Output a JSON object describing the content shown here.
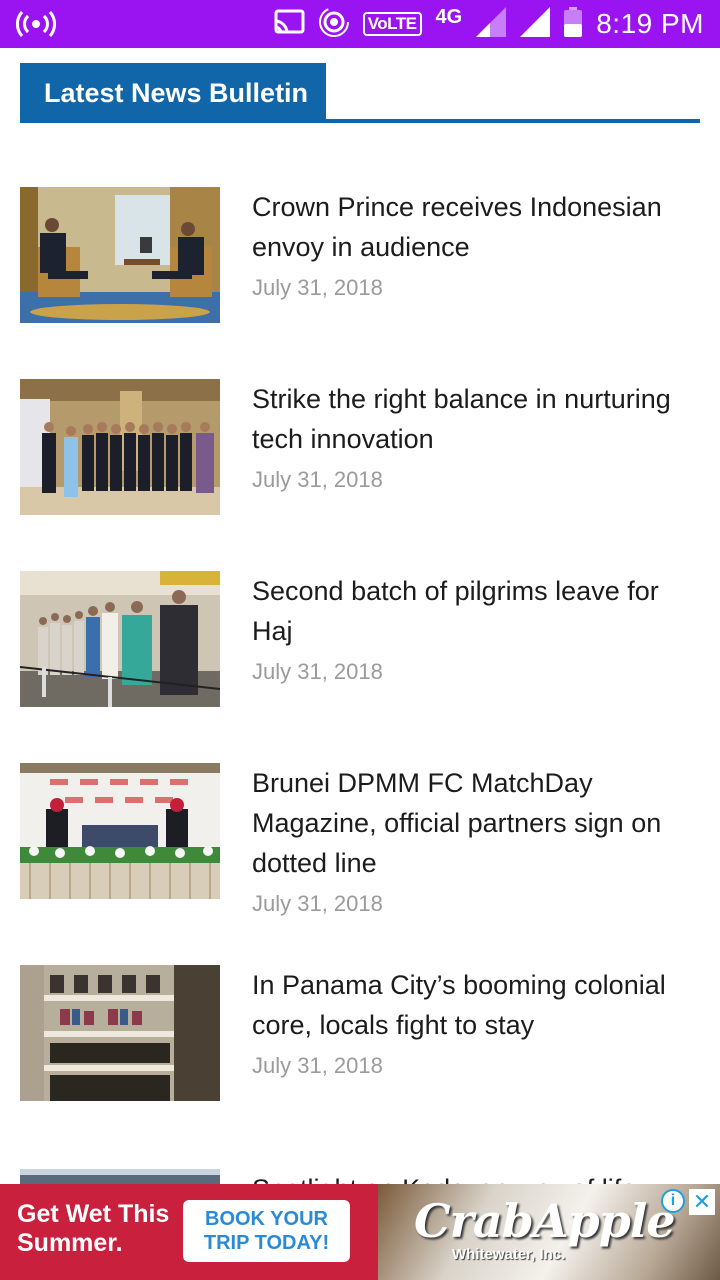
{
  "status_bar": {
    "left_icon": "broadcast-icon",
    "icons": [
      "cast-icon",
      "hotspot-icon",
      "volte-icon",
      "signal-icon",
      "signal-icon",
      "battery-icon"
    ],
    "volte_label": "VoLTE",
    "network_label": "4G",
    "time": "8:19 PM"
  },
  "header": {
    "title": "Latest News Bulletin",
    "accent_color": "#1166aa"
  },
  "news": [
    {
      "headline": "Crown Prince receives Indonesian envoy in audience",
      "date": "July 31, 2018"
    },
    {
      "headline": "Strike the right balance in nurturing tech innovation",
      "date": "July 31, 2018"
    },
    {
      "headline": "Second batch of pilgrims leave for Haj",
      "date": "July 31, 2018"
    },
    {
      "headline": "Brunei DPMM FC MatchDay Magazine, official partners sign on dotted line",
      "date": "July 31, 2018"
    },
    {
      "headline": "In Panama City’s booming colonial core, locals fight to stay",
      "date": "July 31, 2018"
    },
    {
      "headline": "Spotlight on Kedayan way of life",
      "date": ""
    }
  ],
  "ad": {
    "line1": "Get Wet This",
    "line2": "Summer.",
    "cta_line1": "BOOK YOUR",
    "cta_line2": "TRIP TODAY!",
    "brand": "CrabApple",
    "sub": "Whitewater, Inc.",
    "info_icon": "info-icon",
    "close_icon": "close-icon"
  }
}
